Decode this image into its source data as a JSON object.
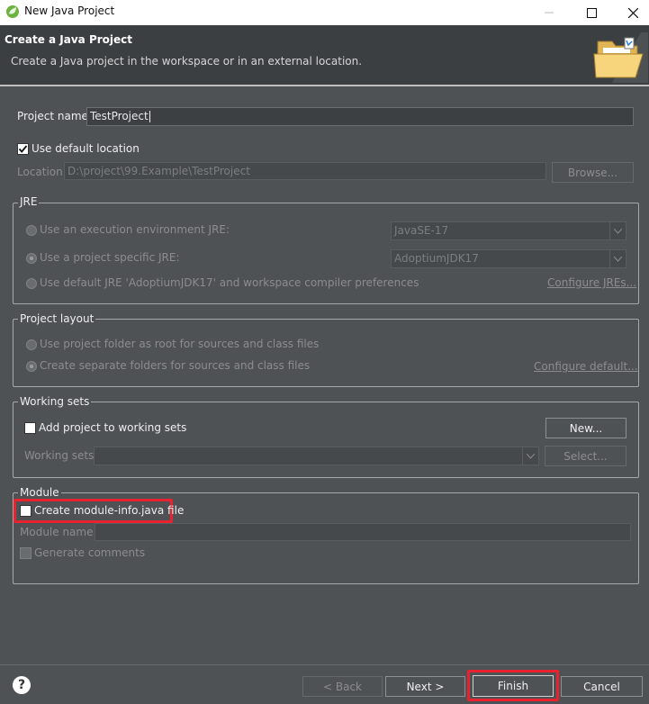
{
  "window": {
    "title": "New Java Project",
    "controls": [
      "minimize-icon",
      "maximize-icon",
      "close-icon"
    ]
  },
  "banner": {
    "heading": "Create a Java Project",
    "description": "Create a Java project in the workspace or in an external location."
  },
  "project": {
    "name_label": "Project name:",
    "name_value": "TestProject",
    "use_default_location_label": "Use default location",
    "use_default_location_checked": true,
    "location_label": "Location:",
    "location_value": "D:\\project\\99.Example\\TestProject",
    "browse_label": "Browse..."
  },
  "jre": {
    "title": "JRE",
    "option_env_label": "Use an execution environment JRE:",
    "option_env_value": "JavaSE-17",
    "option_specific_label": "Use a project specific JRE:",
    "option_specific_value": "AdoptiumJDK17",
    "option_default_label": "Use default JRE 'AdoptiumJDK17' and workspace compiler preferences",
    "configure_link": "Configure JREs..."
  },
  "layout": {
    "title": "Project layout",
    "option_root_label": "Use project folder as root for sources and class files",
    "option_separate_label": "Create separate folders for sources and class files",
    "configure_link": "Configure default..."
  },
  "working_sets": {
    "title": "Working sets",
    "add_label": "Add project to working sets",
    "add_checked": false,
    "new_label": "New...",
    "sets_label": "Working sets:",
    "select_label": "Select..."
  },
  "module": {
    "title": "Module",
    "create_label": "Create module-info.java file",
    "create_checked": false,
    "name_label": "Module name:",
    "generate_comments_label": "Generate comments"
  },
  "footer": {
    "back_label": "< Back",
    "next_label": "Next >",
    "finish_label": "Finish",
    "cancel_label": "Cancel"
  },
  "colors": {
    "background": "#4f5255",
    "banner": "#3c3f41",
    "highlight": "#e8232f"
  }
}
